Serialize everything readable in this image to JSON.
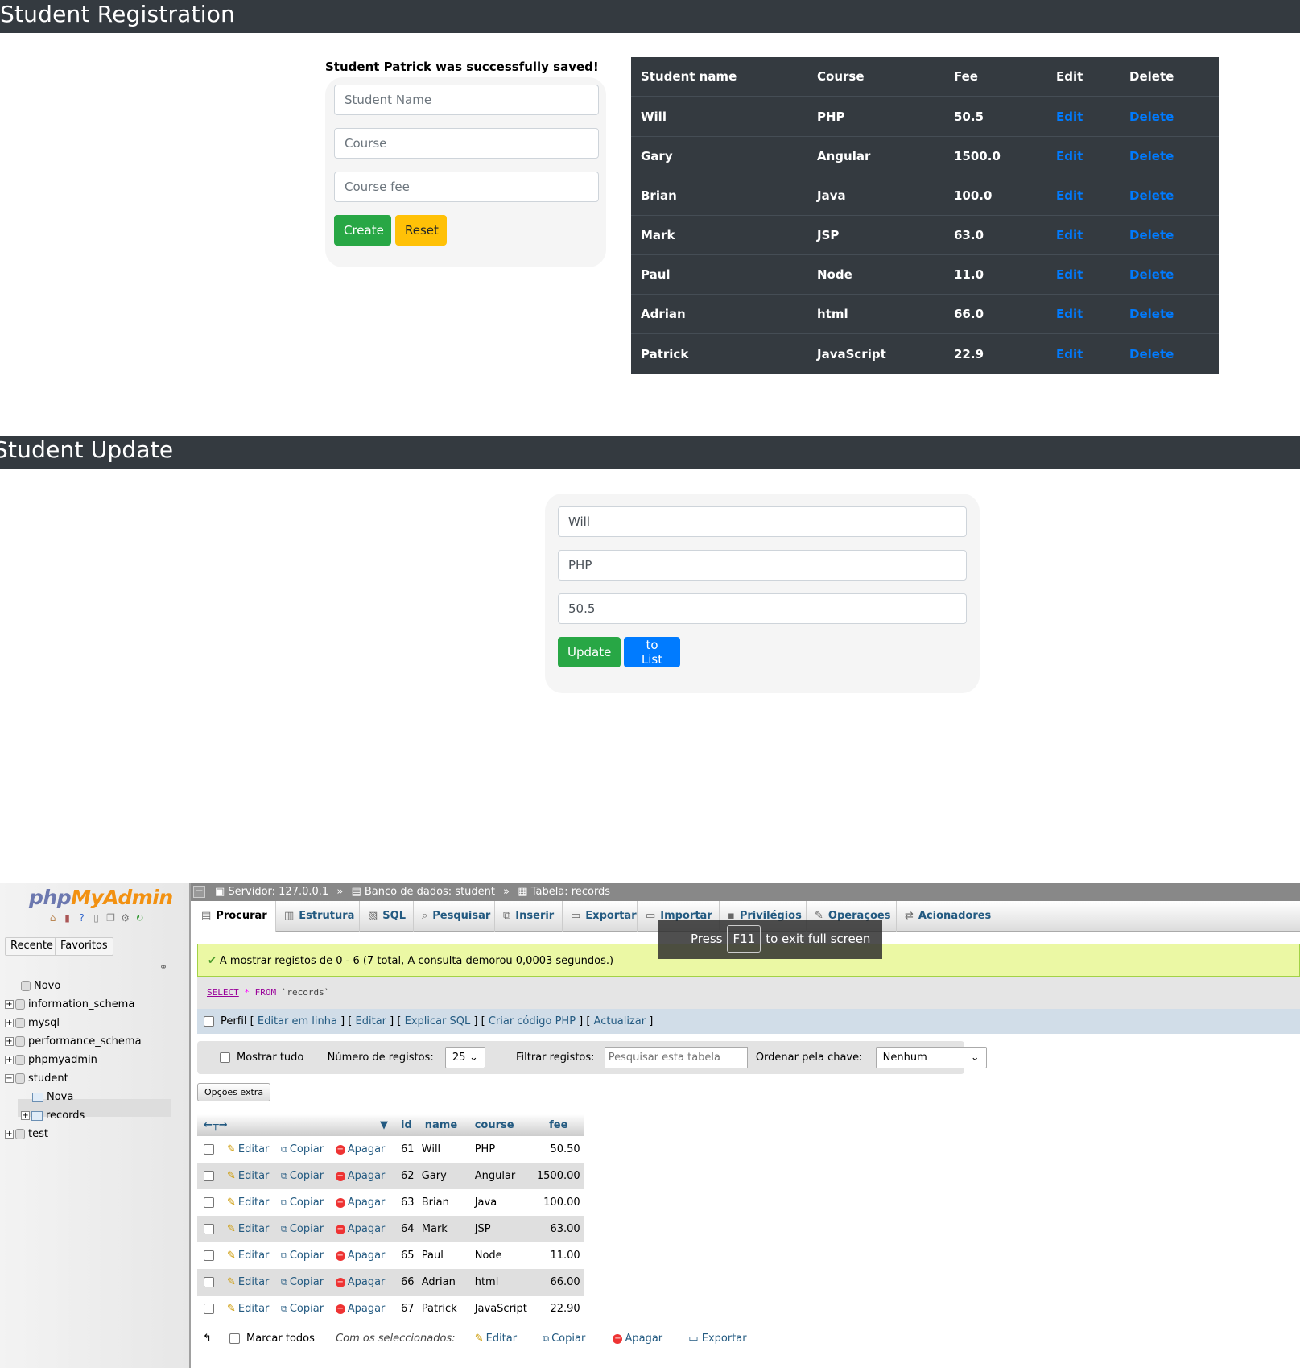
{
  "registration": {
    "header": "Student Registration",
    "status": "Student Patrick was successfully saved!",
    "name_placeholder": "Student Name",
    "course_placeholder": "Course",
    "fee_placeholder": "Course fee",
    "create_label": "Create",
    "reset_label": "Reset"
  },
  "student_table": {
    "columns": [
      "Student name",
      "Course",
      "Fee",
      "Edit",
      "Delete"
    ],
    "rows": [
      {
        "name": "Will",
        "course": "PHP",
        "fee": "50.5",
        "edit": "Edit",
        "delete": "Delete"
      },
      {
        "name": "Gary",
        "course": "Angular",
        "fee": "1500.0",
        "edit": "Edit",
        "delete": "Delete"
      },
      {
        "name": "Brian",
        "course": "Java",
        "fee": "100.0",
        "edit": "Edit",
        "delete": "Delete"
      },
      {
        "name": "Mark",
        "course": "JSP",
        "fee": "63.0",
        "edit": "Edit",
        "delete": "Delete"
      },
      {
        "name": "Paul",
        "course": "Node",
        "fee": "11.0",
        "edit": "Edit",
        "delete": "Delete"
      },
      {
        "name": "Adrian",
        "course": "html",
        "fee": "66.0",
        "edit": "Edit",
        "delete": "Delete"
      },
      {
        "name": "Patrick",
        "course": "JavaScript",
        "fee": "22.9",
        "edit": "Edit",
        "delete": "Delete"
      }
    ]
  },
  "update": {
    "header": "Student Update",
    "name_value": "Will",
    "course_value": "PHP",
    "fee_value": "50.5",
    "update_label": "Update",
    "list_label": "to List"
  },
  "pma": {
    "logo_php": "php",
    "logo_myadmin": "MyAdmin",
    "nav_recent": "Recente",
    "nav_favorites": "Favoritos",
    "tree": {
      "new": "Novo",
      "dbs": [
        "information_schema",
        "mysql",
        "performance_schema",
        "phpmyadmin",
        "student"
      ],
      "student_new": "Nova",
      "student_table": "records",
      "test": "test"
    },
    "breadcrumb": {
      "server": "Servidor: 127.0.0.1",
      "sep": "»",
      "database": "Banco de dados: student",
      "table": "Tabela: records"
    },
    "tabs": [
      "Procurar",
      "Estrutura",
      "SQL",
      "Pesquisar",
      "Inserir",
      "Exportar",
      "Importar",
      "Privilégios",
      "Operações",
      "Acionadores"
    ],
    "f11": {
      "press": "Press",
      "key": "F11",
      "rest": "to exit full screen"
    },
    "success": "A mostrar registos de 0 - 6 (7 total, A consulta demorou 0,0003 segundos.)",
    "sql": {
      "select": "SELECT",
      "star": "*",
      "from": "FROM",
      "table": "`records`"
    },
    "profile": {
      "label": "Perfil",
      "edit_inline": "Editar em linha",
      "edit": "Editar",
      "explain": "Explicar SQL",
      "php_code": "Criar código PHP",
      "refresh": "Actualizar"
    },
    "navbar": {
      "show_all": "Mostrar tudo",
      "num_rows_label": "Número de registos:",
      "num_rows_value": "25",
      "filter_label": "Filtrar registos:",
      "filter_placeholder": "Pesquisar esta tabela",
      "sort_label": "Ordenar pela chave:",
      "sort_value": "Nenhum"
    },
    "extra_options": "Opções extra",
    "columns": [
      "id",
      "name",
      "course",
      "fee"
    ],
    "actions": {
      "edit": "Editar",
      "copy": "Copiar",
      "delete": "Apagar"
    },
    "rows": [
      {
        "id": "61",
        "name": "Will",
        "course": "PHP",
        "fee": "50.50"
      },
      {
        "id": "62",
        "name": "Gary",
        "course": "Angular",
        "fee": "1500.00"
      },
      {
        "id": "63",
        "name": "Brian",
        "course": "Java",
        "fee": "100.00"
      },
      {
        "id": "64",
        "name": "Mark",
        "course": "JSP",
        "fee": "63.00"
      },
      {
        "id": "65",
        "name": "Paul",
        "course": "Node",
        "fee": "11.00"
      },
      {
        "id": "66",
        "name": "Adrian",
        "course": "html",
        "fee": "66.00"
      },
      {
        "id": "67",
        "name": "Patrick",
        "course": "JavaScript",
        "fee": "22.90"
      }
    ],
    "bottom": {
      "check_all": "Marcar todos",
      "with_selected": "Com os seleccionados:",
      "edit": "Editar",
      "copy": "Copiar",
      "delete": "Apagar",
      "export": "Exportar"
    }
  }
}
